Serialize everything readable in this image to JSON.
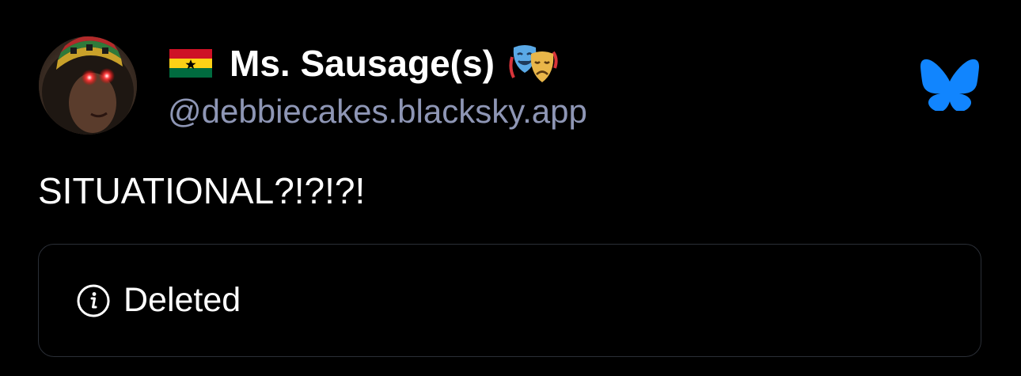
{
  "post": {
    "author": {
      "flag_icon": "ghana-flag-icon",
      "display_name": "Ms. Sausage(s)",
      "emoji_icon": "performing-arts-masks-icon",
      "handle": "@debbiecakes.blacksky.app"
    },
    "app_icon": "bluesky-butterfly-icon",
    "text": "SITUATIONAL?!?!?!",
    "embed": {
      "icon": "info-icon",
      "label": "Deleted"
    }
  },
  "colors": {
    "background": "#000000",
    "text": "#ffffff",
    "handle": "#8e96b5",
    "border": "#2a2e36",
    "bluesky_blue": "#1185fe"
  }
}
